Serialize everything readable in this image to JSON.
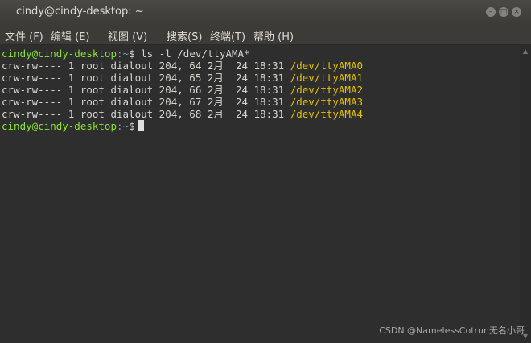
{
  "window": {
    "title": "cindy@cindy-desktop: ~",
    "minimize_glyph": "–",
    "maximize_glyph": "□",
    "close_glyph": "×"
  },
  "menubar": {
    "items": [
      "文件 (F)",
      "编辑 (E)",
      "视图 (V)",
      "搜索(S)",
      "终端(T)",
      "帮助 (H)"
    ]
  },
  "terminal": {
    "prompt_user": "cindy@cindy-desktop",
    "prompt_path": ":~",
    "prompt_symbol": "$",
    "command": " ls -l /dev/ttyAMA*",
    "listing": [
      {
        "prefix": "crw-rw---- 1 root dialout 204, 64 2月  24 18:31 ",
        "device": "/dev/ttyAMA0"
      },
      {
        "prefix": "crw-rw---- 1 root dialout 204, 65 2月  24 18:31 ",
        "device": "/dev/ttyAMA1"
      },
      {
        "prefix": "crw-rw---- 1 root dialout 204, 66 2月  24 18:31 ",
        "device": "/dev/ttyAMA2"
      },
      {
        "prefix": "crw-rw---- 1 root dialout 204, 67 2月  24 18:31 ",
        "device": "/dev/ttyAMA3"
      },
      {
        "prefix": "crw-rw---- 1 root dialout 204, 68 2月  24 18:31 ",
        "device": "/dev/ttyAMA4"
      }
    ]
  },
  "colors": {
    "terminal_bg": "#2e2e2e",
    "prompt_user": "#8ae234",
    "prompt_path": "#729fcf",
    "device_name": "#e5c100",
    "titlebar": "#3c3b37"
  },
  "watermark": "CSDN @NamelessCotrun无名小哥"
}
